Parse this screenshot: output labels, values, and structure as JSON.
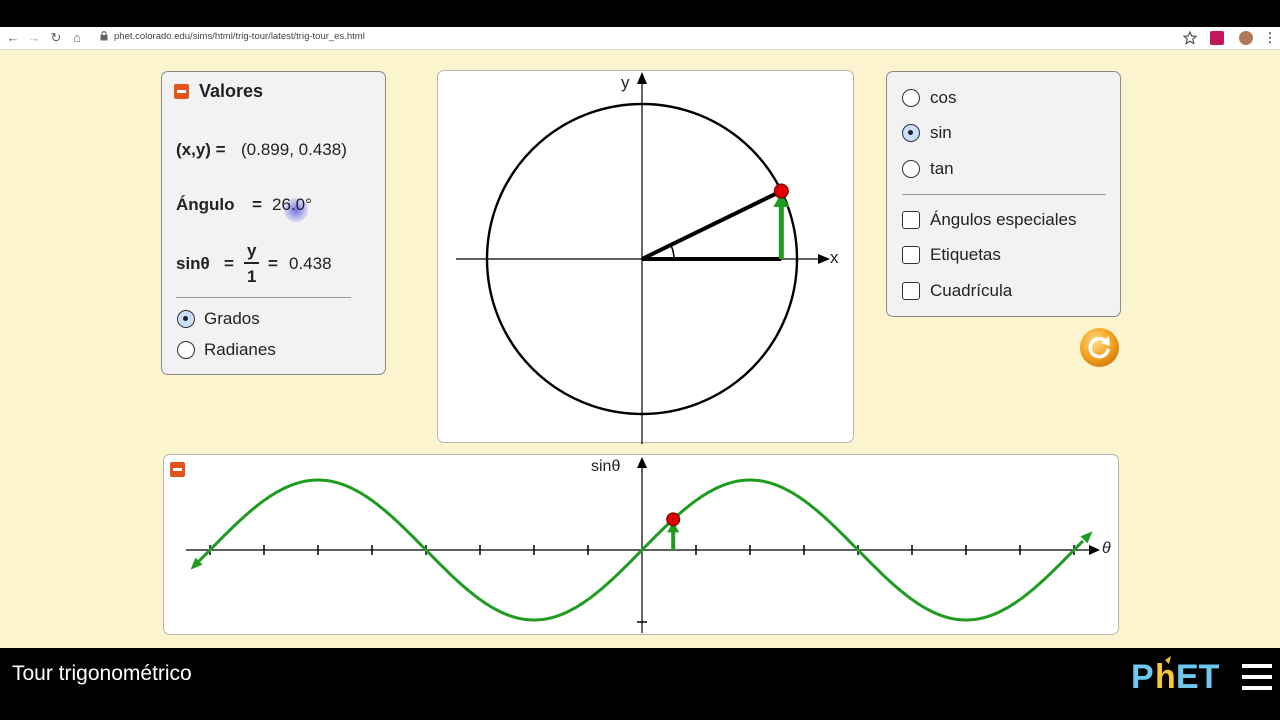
{
  "browser": {
    "url": "phet.colorado.edu/sims/html/trig-tour/latest/trig-tour_es.html"
  },
  "values_panel": {
    "title": "Valores",
    "xy_label": "(x,y) =",
    "xy_value": "(0.899, 0.438)",
    "angle_label": "Ángulo",
    "equals": "=",
    "angle_value": "26.0°",
    "sin_label": "sinθ",
    "frac_num": "y",
    "frac_den": "1",
    "sin_value": "0.438",
    "radio_options": [
      {
        "label": "Grados",
        "selected": true
      },
      {
        "label": "Radianes",
        "selected": false
      }
    ]
  },
  "unit_circle": {
    "x_axis_label": "x",
    "y_axis_label": "y",
    "angle_degrees": 26.0
  },
  "options_panel": {
    "functions": [
      {
        "label": "cos",
        "selected": false
      },
      {
        "label": "sin",
        "selected": true
      },
      {
        "label": "tan",
        "selected": false
      }
    ],
    "checkboxes": [
      {
        "label": "Ángulos especiales",
        "checked": false
      },
      {
        "label": "Etiquetas",
        "checked": false
      },
      {
        "label": "Cuadrícula",
        "checked": false
      }
    ]
  },
  "graph": {
    "y_axis_label": "sinθ",
    "x_axis_label": "θ",
    "function": "sin",
    "current_theta_degrees": 26.0
  },
  "footer": {
    "title": "Tour trigonométrico",
    "logo": "PhET"
  },
  "colors": {
    "background": "#fbf4ce",
    "accent_orange": "#e2541b",
    "curve_green": "#1f9c1f",
    "point_red": "#e00000",
    "reset_orange": "#f5a623"
  }
}
